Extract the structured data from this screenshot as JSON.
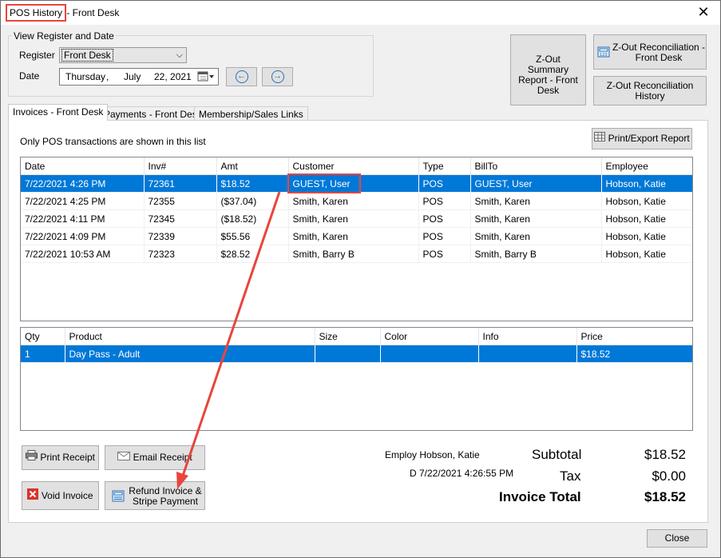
{
  "window": {
    "title_highlight": "POS History",
    "title_rest": " - Front Desk",
    "close_glyph": "✕"
  },
  "view_register": {
    "group_label": "View Register and Date",
    "register_label": "Register",
    "register_value": "Front Desk",
    "date_label": "Date",
    "date_weekday": "Thursday",
    "date_sep": ",",
    "date_month": "July",
    "date_day_year": "22, 2021"
  },
  "zout": {
    "summary_label": "Z-Out Summary Report - Front Desk",
    "recon_label_1": "Z-Out Reconciliation -",
    "recon_label_2": "Front Desk",
    "recon_history_label": "Z-Out Reconciliation History"
  },
  "tabs": [
    "Invoices - Front Desk",
    "Payments - Front Desk",
    "Membership/Sales Links"
  ],
  "notice": "Only POS transactions are shown in this list",
  "print_export_label": "Print/Export Report",
  "invoices": {
    "columns": [
      "Date",
      "Inv#",
      "Amt",
      "Customer",
      "Type",
      "BillTo",
      "Employee"
    ],
    "rows": [
      [
        "7/22/2021 4:26 PM",
        "72361",
        "$18.52",
        "GUEST, User",
        "POS",
        "GUEST, User",
        "Hobson, Katie"
      ],
      [
        "7/22/2021 4:25 PM",
        "72355",
        "($37.04)",
        "Smith, Karen",
        "POS",
        "Smith, Karen",
        "Hobson, Katie"
      ],
      [
        "7/22/2021 4:11 PM",
        "72345",
        "($18.52)",
        "Smith, Karen",
        "POS",
        "Smith, Karen",
        "Hobson, Katie"
      ],
      [
        "7/22/2021 4:09 PM",
        "72339",
        "$55.56",
        "Smith, Karen",
        "POS",
        "Smith, Karen",
        "Hobson, Katie"
      ],
      [
        "7/22/2021 10:53 AM",
        "72323",
        "$28.52",
        "Smith, Barry B",
        "POS",
        "Smith, Barry B",
        "Hobson, Katie"
      ]
    ]
  },
  "items": {
    "columns": [
      "Qty",
      "Product",
      "Size",
      "Color",
      "Info",
      "Price"
    ],
    "rows": [
      [
        "1",
        "Day Pass - Adult",
        "",
        "",
        "",
        "$18.52"
      ]
    ]
  },
  "actions": {
    "print_receipt": "Print Receipt",
    "email_receipt": "Email Receipt",
    "void_invoice": "Void Invoice",
    "refund_1": "Refund Invoice &",
    "refund_2": "Stripe Payment"
  },
  "summary": {
    "employee": "Employ Hobson, Katie",
    "date": "D 7/22/2021 4:26:55 PM",
    "subtotal_label": "Subtotal",
    "subtotal_value": "$18.52",
    "tax_label": "Tax",
    "tax_value": "$0.00",
    "total_label": "Invoice Total",
    "total_value": "$18.52"
  },
  "close_label": "Close",
  "colors": {
    "selection": "#0078d7",
    "annotation": "#e8453c"
  }
}
